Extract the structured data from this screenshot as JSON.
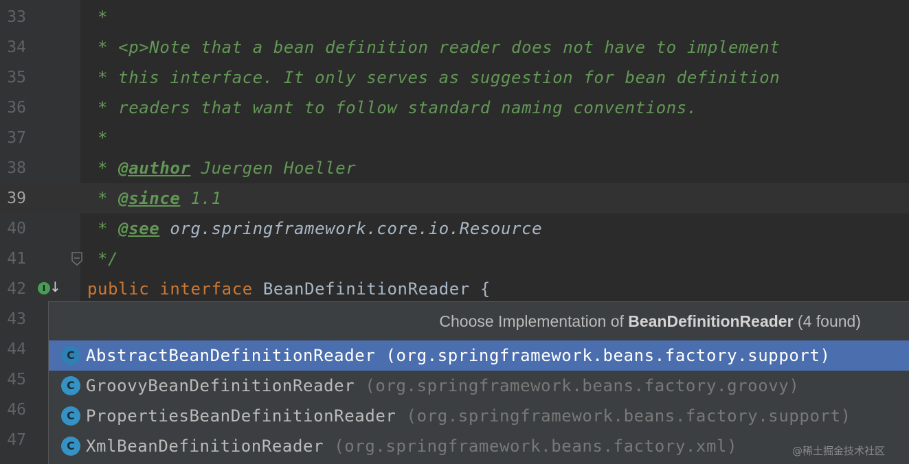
{
  "editor": {
    "lines": [
      {
        "num": "33",
        "text": " *"
      },
      {
        "num": "34",
        "text": " * <p>Note that a bean definition reader does not have to implement"
      },
      {
        "num": "35",
        "text": " * this interface. It only serves as suggestion for bean definition"
      },
      {
        "num": "36",
        "text": " * readers that want to follow standard naming conventions."
      },
      {
        "num": "37",
        "text": " *"
      },
      {
        "num": "38",
        "pre": " * ",
        "tag": "@author",
        "post": " Juergen Hoeller"
      },
      {
        "num": "39",
        "pre": " * ",
        "tag": "@since",
        "post": " 1.1"
      },
      {
        "num": "40",
        "pre": " * ",
        "tag": "@see",
        "post": " org.springframework.core.io.Resource"
      },
      {
        "num": "41",
        "text": " */"
      },
      {
        "num": "42",
        "kw1": "public",
        "kw2": "interface",
        "name": "BeanDefinitionReader",
        "brace": "{"
      },
      {
        "num": "43"
      },
      {
        "num": "44"
      },
      {
        "num": "45"
      },
      {
        "num": "46"
      },
      {
        "num": "47"
      }
    ],
    "current_line": "39",
    "gutter_icon": "implemented-interface-icon",
    "colors": {
      "background": "#2b2b2b",
      "doc_comment": "#629755",
      "keyword": "#cc7832",
      "identifier": "#a9b7c6"
    }
  },
  "popup": {
    "title_prefix": "Choose Implementation of ",
    "title_class": "BeanDefinitionReader",
    "title_suffix": " (4 found)",
    "items": [
      {
        "name": "AbstractBeanDefinitionReader",
        "package": "(org.springframework.beans.factory.support)",
        "icon": "class-icon",
        "selected": true
      },
      {
        "name": "GroovyBeanDefinitionReader",
        "package": "(org.springframework.beans.factory.groovy)",
        "icon": "class-icon"
      },
      {
        "name": "PropertiesBeanDefinitionReader",
        "package": "(org.springframework.beans.factory.support)",
        "icon": "class-icon"
      },
      {
        "name": "XmlBeanDefinitionReader",
        "package": "(org.springframework.beans.factory.xml)",
        "icon": "class-icon"
      }
    ],
    "icon_letter": "C",
    "selection_color": "#4b6eaf"
  },
  "watermark": "@稀土掘金技术社区"
}
